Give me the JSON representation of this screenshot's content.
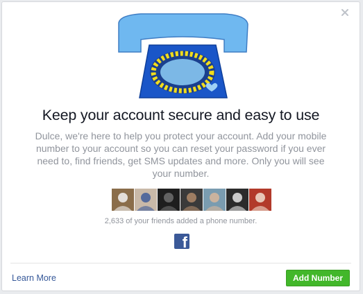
{
  "dialog": {
    "title": "Keep your account secure and easy to use",
    "body": "Dulce, we're here to help you protect your account. Add your mobile number to your account so you can reset your password if you ever need to, find friends, get SMS updates and more. Only you will see your number.",
    "friends_count_text": "2,633 of your friends added a phone number.",
    "learn_more_label": "Learn More",
    "add_number_label": "Add Number",
    "icons": {
      "close": "close-icon",
      "hero": "telephone-illustration",
      "brand": "facebook-icon"
    },
    "friend_avatars": [
      {
        "name": "friend-avatar-1",
        "bg": "#8a6d4a",
        "accent": "#f2f2f2"
      },
      {
        "name": "friend-avatar-2",
        "bg": "#c9b9a8",
        "accent": "#3f5c9a"
      },
      {
        "name": "friend-avatar-3",
        "bg": "#1e1e1e",
        "accent": "#6e6e6e"
      },
      {
        "name": "friend-avatar-4",
        "bg": "#3a3a3a",
        "accent": "#b08a6a"
      },
      {
        "name": "friend-avatar-5",
        "bg": "#7a9cb0",
        "accent": "#d9b79b"
      },
      {
        "name": "friend-avatar-6",
        "bg": "#2b2b2b",
        "accent": "#e6e6e6"
      },
      {
        "name": "friend-avatar-7",
        "bg": "#b23a2a",
        "accent": "#f0e0d0"
      }
    ],
    "colors": {
      "phone_blue": "#1a56c8",
      "handset_blue": "#6fb8f0",
      "dial_yellow": "#f2dd1c",
      "button_green": "#42b72a",
      "link_blue": "#365899",
      "fb_blue": "#3b5998"
    }
  }
}
